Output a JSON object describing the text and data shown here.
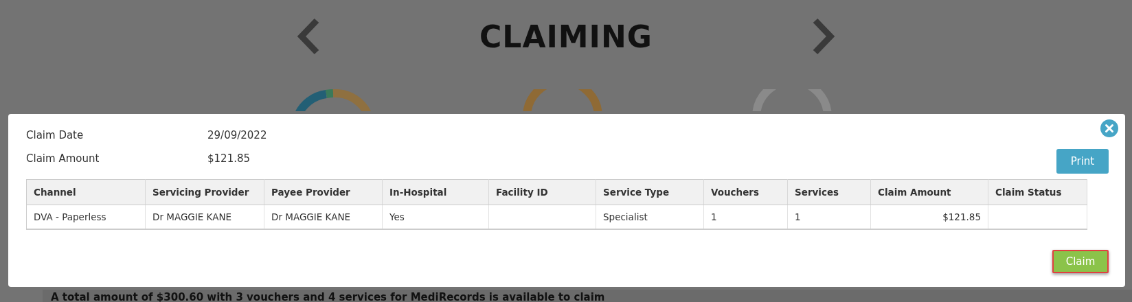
{
  "page": {
    "title": "CLAIMING",
    "summary": "A total amount of $300.60 with 3 vouchers and 4 services for MediRecords is available to claim"
  },
  "modal": {
    "fields": [
      {
        "label": "Claim Date",
        "value": "29/09/2022"
      },
      {
        "label": "Claim Amount",
        "value": "$121.85"
      }
    ],
    "print_button": "Print",
    "claim_button": {
      "label": "Claim",
      "focused": true
    },
    "table": {
      "columns": [
        {
          "label": "Channel",
          "kind": "text"
        },
        {
          "label": "Servicing Provider",
          "kind": "text"
        },
        {
          "label": "Payee Provider",
          "kind": "text"
        },
        {
          "label": "In-Hospital",
          "kind": "text"
        },
        {
          "label": "Facility ID",
          "kind": "text"
        },
        {
          "label": "Service Type",
          "kind": "text"
        },
        {
          "label": "Vouchers",
          "kind": "text"
        },
        {
          "label": "Services",
          "kind": "text"
        },
        {
          "label": "Claim Amount",
          "kind": "amount"
        },
        {
          "label": "Claim Status",
          "kind": "text"
        }
      ],
      "rows": [
        [
          "DVA - Paperless",
          "Dr MAGGIE KANE",
          "Dr MAGGIE KANE",
          "Yes",
          "",
          "Specialist",
          "1",
          "1",
          "$121.85",
          ""
        ]
      ]
    }
  }
}
